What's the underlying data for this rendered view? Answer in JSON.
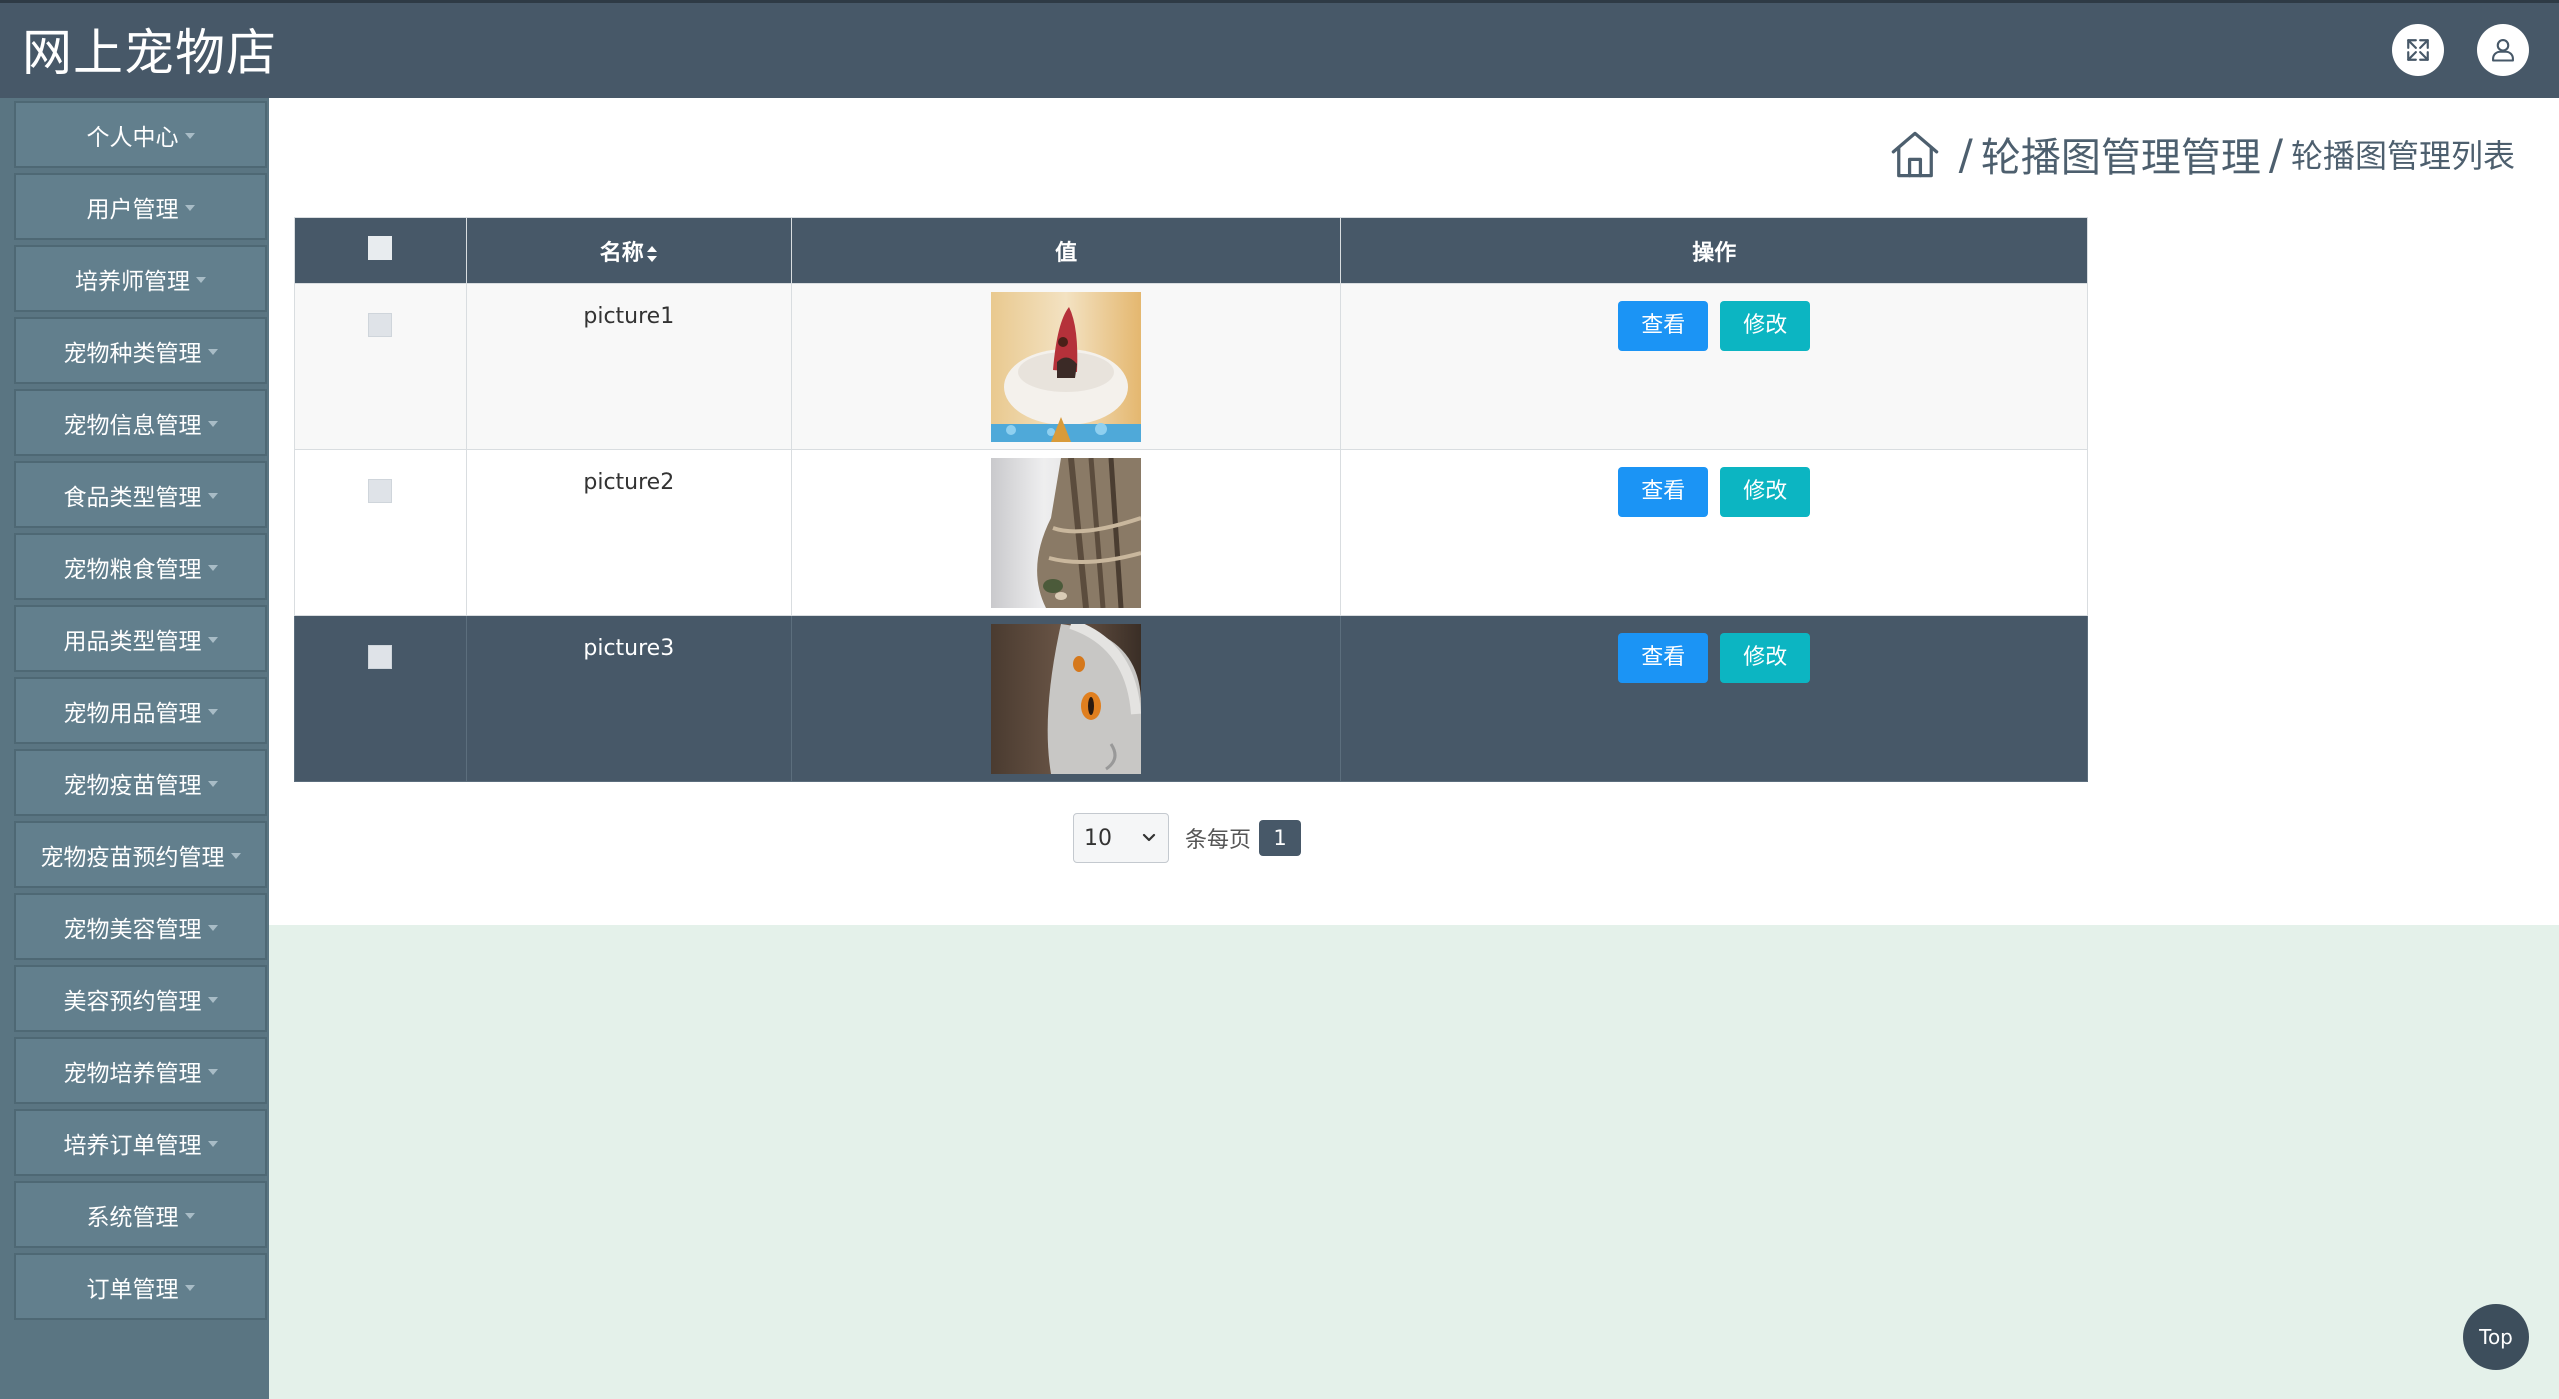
{
  "app": {
    "title": "网上宠物店"
  },
  "header": {
    "fullscreen_icon": "fullscreen-icon",
    "user_icon": "user-icon"
  },
  "sidebar": {
    "items": [
      {
        "label": "个人中心"
      },
      {
        "label": "用户管理"
      },
      {
        "label": "培养师管理"
      },
      {
        "label": "宠物种类管理"
      },
      {
        "label": "宠物信息管理"
      },
      {
        "label": "食品类型管理"
      },
      {
        "label": "宠物粮食管理"
      },
      {
        "label": "用品类型管理"
      },
      {
        "label": "宠物用品管理"
      },
      {
        "label": "宠物疫苗管理"
      },
      {
        "label": "宠物疫苗预约管理"
      },
      {
        "label": "宠物美容管理"
      },
      {
        "label": "美容预约管理"
      },
      {
        "label": "宠物培养管理"
      },
      {
        "label": "培养订单管理"
      },
      {
        "label": "系统管理"
      },
      {
        "label": "订单管理"
      }
    ]
  },
  "breadcrumb": {
    "home_icon": "home-icon",
    "separator": "/",
    "level1": "轮播图管理管理",
    "level2": "轮播图管理列表"
  },
  "table": {
    "headers": {
      "name": "名称",
      "value": "值",
      "actions": "操作"
    },
    "rows": [
      {
        "name": "picture1",
        "view_label": "查看",
        "edit_label": "修改"
      },
      {
        "name": "picture2",
        "view_label": "查看",
        "edit_label": "修改"
      },
      {
        "name": "picture3",
        "view_label": "查看",
        "edit_label": "修改"
      }
    ]
  },
  "pagination": {
    "page_size": "10",
    "per_page_label": "条每页",
    "current_page": "1"
  },
  "back_to_top": {
    "label": "Top"
  },
  "colors": {
    "header_bg": "#475868",
    "sidebar_bg": "#5a7582",
    "view_button": "#1b94f5",
    "edit_button": "#0cb5c2",
    "page_bg": "#e4f1ea"
  }
}
